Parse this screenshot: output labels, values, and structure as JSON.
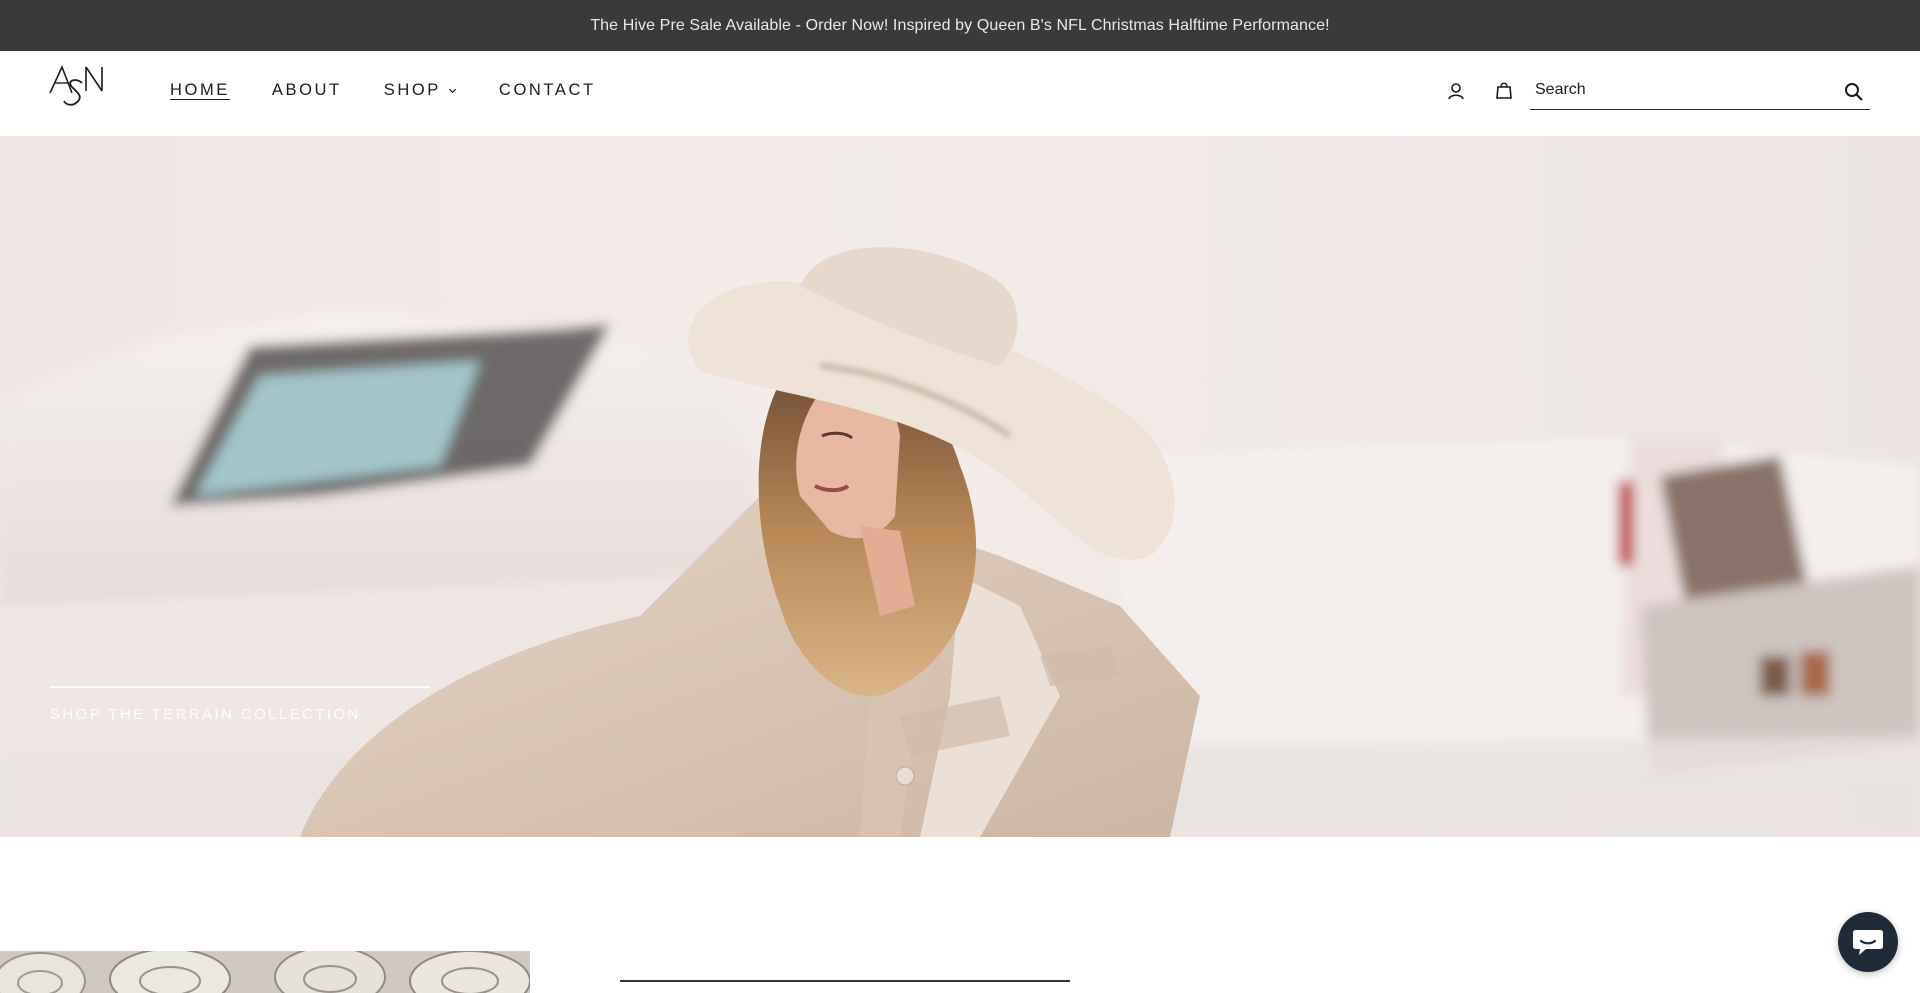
{
  "announcement": {
    "text": "The Hive Pre Sale Available - Order Now! Inspired by Queen B's NFL Christmas Halftime Performance!"
  },
  "header": {
    "logo_text": "ASN",
    "nav": [
      {
        "label": "HOME",
        "active": true
      },
      {
        "label": "ABOUT"
      },
      {
        "label": "SHOP",
        "has_dropdown": true
      },
      {
        "label": "CONTACT"
      }
    ],
    "icons": {
      "account": "user-icon",
      "cart": "shopping-bag-icon",
      "search": "search-icon"
    },
    "search": {
      "placeholder": "Search",
      "value": ""
    }
  },
  "hero": {
    "cta_label": "SHOP THE TERRAIN COLLECTION",
    "image": "woman in wide-brim cream hat and linen blazer beside white vintage convertible"
  },
  "chat": {
    "icon": "chat-bubble-icon"
  },
  "colors": {
    "announcement_bg": "#3a3a3a",
    "chat_bg": "#1f2b38"
  }
}
